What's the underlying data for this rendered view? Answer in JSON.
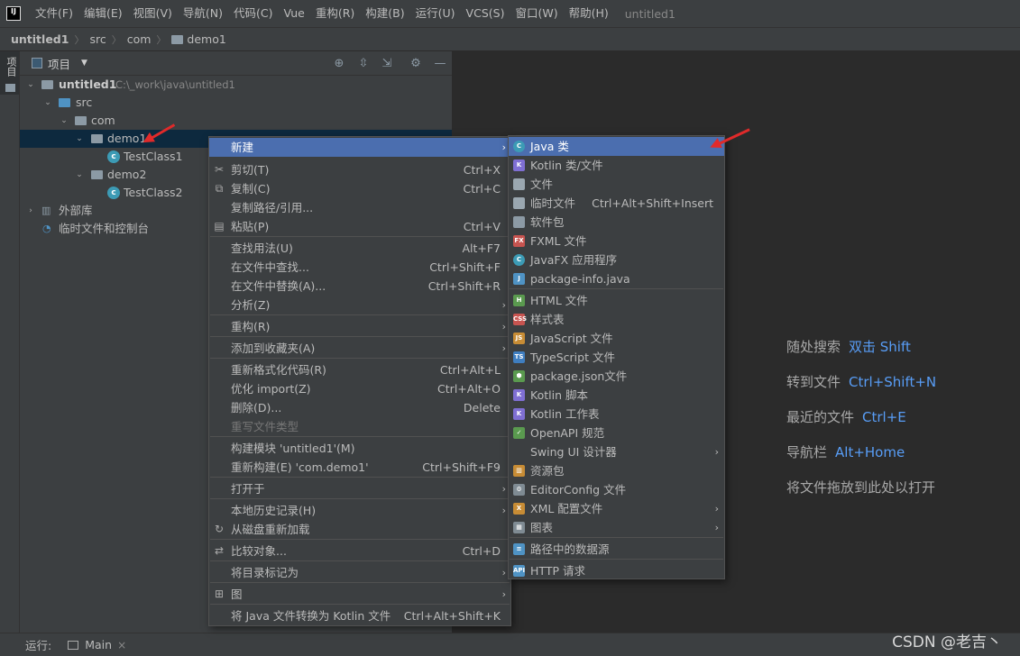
{
  "menubar": {
    "items": [
      "文件(F)",
      "编辑(E)",
      "视图(V)",
      "导航(N)",
      "代码(C)",
      "Vue",
      "重构(R)",
      "构建(B)",
      "运行(U)",
      "VCS(S)",
      "窗口(W)",
      "帮助(H)"
    ],
    "app_title": "untitled1"
  },
  "breadcrumb": [
    "untitled1",
    "src",
    "com",
    "demo1"
  ],
  "left_strip": {
    "label": "项目"
  },
  "project_panel": {
    "title": "项目",
    "tree": {
      "root_name": "untitled1",
      "root_path": "C:\\_work\\java\\untitled1",
      "src": "src",
      "com": "com",
      "demo1": "demo1",
      "testclass1": "TestClass1",
      "demo2": "demo2",
      "testclass2": "TestClass2",
      "external_libs": "外部库",
      "scratches": "临时文件和控制台"
    }
  },
  "context_menu": {
    "items": [
      {
        "label": "新建",
        "shortcut": "",
        "sub": true,
        "icon": ""
      },
      {
        "label": "剪切(T)",
        "shortcut": "Ctrl+X",
        "icon": "scissors-icon"
      },
      {
        "label": "复制(C)",
        "shortcut": "Ctrl+C",
        "icon": "copy-icon"
      },
      {
        "label": "复制路径/引用...",
        "shortcut": "",
        "icon": ""
      },
      {
        "label": "粘贴(P)",
        "shortcut": "Ctrl+V",
        "icon": "paste-icon"
      },
      {
        "label": "查找用法(U)",
        "shortcut": "Alt+F7",
        "icon": ""
      },
      {
        "label": "在文件中查找...",
        "shortcut": "Ctrl+Shift+F",
        "icon": ""
      },
      {
        "label": "在文件中替换(A)...",
        "shortcut": "Ctrl+Shift+R",
        "icon": ""
      },
      {
        "label": "分析(Z)",
        "shortcut": "",
        "sub": true,
        "icon": ""
      },
      {
        "label": "重构(R)",
        "shortcut": "",
        "sub": true,
        "icon": ""
      },
      {
        "label": "添加到收藏夹(A)",
        "shortcut": "",
        "sub": true,
        "icon": ""
      },
      {
        "label": "重新格式化代码(R)",
        "shortcut": "Ctrl+Alt+L",
        "icon": ""
      },
      {
        "label": "优化 import(Z)",
        "shortcut": "Ctrl+Alt+O",
        "icon": ""
      },
      {
        "label": "删除(D)...",
        "shortcut": "Delete",
        "icon": ""
      },
      {
        "label": "重写文件类型",
        "shortcut": "",
        "icon": "",
        "disabled": true
      },
      {
        "label": "构建模块 'untitled1'(M)",
        "shortcut": "",
        "icon": ""
      },
      {
        "label": "重新构建(E) 'com.demo1'",
        "shortcut": "Ctrl+Shift+F9",
        "icon": ""
      },
      {
        "label": "打开于",
        "shortcut": "",
        "sub": true,
        "icon": ""
      },
      {
        "label": "本地历史记录(H)",
        "shortcut": "",
        "sub": true,
        "icon": ""
      },
      {
        "label": "从磁盘重新加载",
        "shortcut": "",
        "icon": "reload-icon"
      },
      {
        "label": "比较对象...",
        "shortcut": "Ctrl+D",
        "icon": "compare-icon"
      },
      {
        "label": "将目录标记为",
        "shortcut": "",
        "sub": true,
        "icon": ""
      },
      {
        "label": "图",
        "shortcut": "",
        "sub": true,
        "icon": "diagram-icon"
      },
      {
        "label": "将 Java 文件转换为 Kotlin 文件",
        "shortcut": "Ctrl+Alt+Shift+K",
        "icon": ""
      }
    ]
  },
  "submenu_new": {
    "items": [
      {
        "label": "Java 类",
        "shortcut": "",
        "icon": "C",
        "color": "#3c9bb5"
      },
      {
        "label": "Kotlin 类/文件",
        "shortcut": "",
        "icon": "K",
        "color": "#7f6fd3"
      },
      {
        "label": "文件",
        "shortcut": "",
        "icon": "",
        "color": "#9aa7b0"
      },
      {
        "label": "临时文件",
        "shortcut": "Ctrl+Alt+Shift+Insert",
        "icon": "",
        "color": "#9aa7b0"
      },
      {
        "label": "软件包",
        "shortcut": "",
        "icon": "",
        "color": "#8c9aa5"
      },
      {
        "label": "FXML 文件",
        "shortcut": "",
        "icon": "FX",
        "color": "#c75450"
      },
      {
        "label": "JavaFX 应用程序",
        "shortcut": "",
        "icon": "C",
        "color": "#3c9bb5"
      },
      {
        "label": "package-info.java",
        "shortcut": "",
        "icon": "J",
        "color": "#4f93c4"
      },
      {
        "label": "HTML 文件",
        "shortcut": "",
        "icon": "H",
        "color": "#5a9a4f"
      },
      {
        "label": "样式表",
        "shortcut": "",
        "icon": "CSS",
        "color": "#c75450"
      },
      {
        "label": "JavaScript 文件",
        "shortcut": "",
        "icon": "JS",
        "color": "#c78c35"
      },
      {
        "label": "TypeScript 文件",
        "shortcut": "",
        "icon": "TS",
        "color": "#3f7ec0"
      },
      {
        "label": "package.json文件",
        "shortcut": "",
        "icon": "⬢",
        "color": "#5a9a4f"
      },
      {
        "label": "Kotlin 脚本",
        "shortcut": "",
        "icon": "K",
        "color": "#7f6fd3"
      },
      {
        "label": "Kotlin 工作表",
        "shortcut": "",
        "icon": "K",
        "color": "#7f6fd3"
      },
      {
        "label": "OpenAPI 规范",
        "shortcut": "",
        "icon": "✓",
        "color": "#5a9a4f"
      },
      {
        "label": "Swing UI 设计器",
        "shortcut": "",
        "icon": "",
        "color": "",
        "sub": true
      },
      {
        "label": "资源包",
        "shortcut": "",
        "icon": "▥",
        "color": "#c78c35"
      },
      {
        "label": "EditorConfig 文件",
        "shortcut": "",
        "icon": "⚙",
        "color": "#7f8b93"
      },
      {
        "label": "XML 配置文件",
        "shortcut": "",
        "icon": "X",
        "color": "#c78c35",
        "sub": true
      },
      {
        "label": "图表",
        "shortcut": "",
        "icon": "▦",
        "color": "#7f8b93",
        "sub": true
      },
      {
        "label": "路径中的数据源",
        "shortcut": "",
        "icon": "≡",
        "color": "#4f93c4"
      },
      {
        "label": "HTTP 请求",
        "shortcut": "",
        "icon": "API",
        "color": "#4f93c4"
      }
    ]
  },
  "editor_hints": [
    {
      "text": "随处搜索",
      "key": "双击 Shift"
    },
    {
      "text": "转到文件",
      "key": "Ctrl+Shift+N"
    },
    {
      "text": "最近的文件",
      "key": "Ctrl+E"
    },
    {
      "text": "导航栏",
      "key": "Alt+Home"
    },
    {
      "text": "将文件拖放到此处以打开",
      "key": ""
    }
  ],
  "statusbar": {
    "run_label": "运行:",
    "run_tab": "Main",
    "close": "×"
  },
  "watermark": "CSDN @老吉丶",
  "colors": {
    "selection": "#4b6eaf",
    "panel": "#3c3f41",
    "editor": "#2b2b2b",
    "link": "#589df6",
    "arrow": "#e02a2a"
  }
}
